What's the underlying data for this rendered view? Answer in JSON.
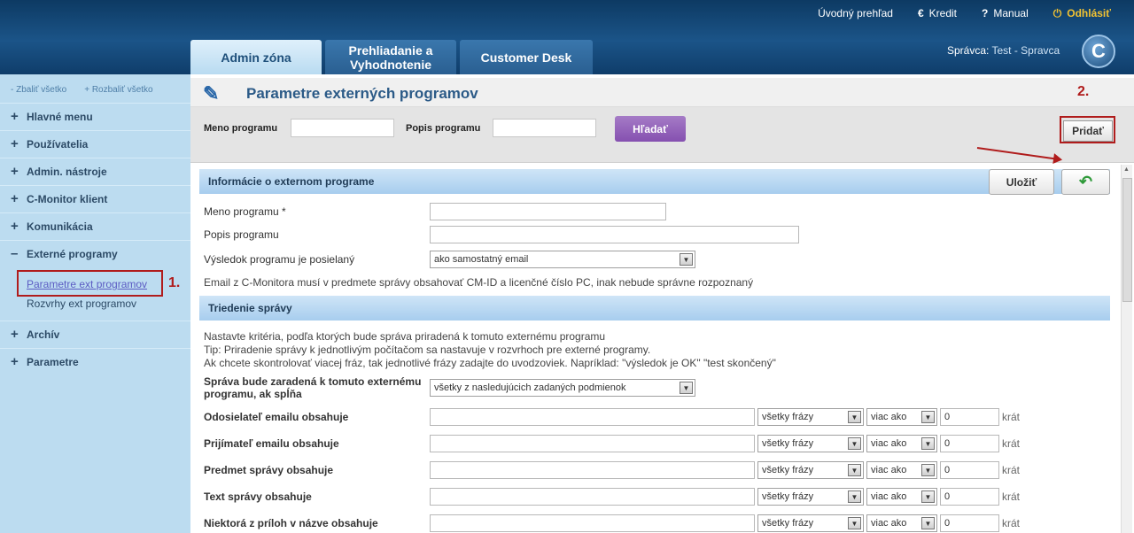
{
  "top_links": {
    "home": "Úvodný prehľad",
    "credit": "Kredit",
    "manual": "Manual",
    "logout": "Odhlásiť"
  },
  "tabs": [
    {
      "label": "Admin zóna"
    },
    {
      "label": "Prehliadanie a Vyhodnotenie"
    },
    {
      "label": "Customer Desk"
    }
  ],
  "user": {
    "prefix": "Správca:",
    "name": "Test - Spravca"
  },
  "logo": "C",
  "sidebar": {
    "collapse_all": "- Zbaliť všetko",
    "expand_all": "+ Rozbaliť všetko",
    "items": [
      {
        "label": "Hlavné menu",
        "sign": "+"
      },
      {
        "label": "Používatelia",
        "sign": "+"
      },
      {
        "label": "Admin. nástroje",
        "sign": "+"
      },
      {
        "label": "C-Monitor klient",
        "sign": "+"
      },
      {
        "label": "Komunikácia",
        "sign": "+"
      },
      {
        "label": "Externé programy",
        "sign": "–"
      },
      {
        "label": "Archív",
        "sign": "+"
      },
      {
        "label": "Parametre",
        "sign": "+"
      }
    ],
    "subitems": [
      {
        "label": "Parametre ext programov"
      },
      {
        "label": "Rozvrhy ext programov"
      }
    ]
  },
  "annotations": {
    "one": "1.",
    "two": "2."
  },
  "page": {
    "title": "Parametre externých programov"
  },
  "search": {
    "name_label": "Meno programu",
    "desc_label": "Popis programu",
    "search_button": "Hľadať",
    "add_button": "Pridať"
  },
  "form": {
    "save_button": "Uložiť",
    "section_info": "Informácie o externom programe",
    "name_label": "Meno programu *",
    "desc_label": "Popis programu",
    "result_label": "Výsledok programu je posielaný",
    "result_value": "ako samostatný email",
    "email_note": "Email z C-Monitora musí v predmete správy obsahovať CM-ID a licenčné číslo PC, inak nebude správne rozpoznaný",
    "section_sort": "Triedenie správy",
    "sort_note_1": "Nastavte kritéria, podľa ktorých bude správa priradená k tomuto externému programu",
    "sort_note_2": "Tip: Priradenie správy k jednotlivým počítačom sa nastavuje v rozvrhoch pre externé programy.",
    "sort_note_3": "Ak chcete skontrolovať viacej fráz, tak jednotlivé frázy zadajte do uvodzoviek. Napríklad: \"výsledok je OK\" \"test skončený\"",
    "match_label": "Správa bude zaradená k tomuto externému programu, ak spĺňa",
    "match_value": "všetky z nasledujúcich zadaných podmienok",
    "krat": "krát",
    "rows": [
      {
        "label": "Odosielateľ emailu obsahuje",
        "phrase": "všetky frázy",
        "cmp": "viac ako",
        "count": "0"
      },
      {
        "label": "Prijímateľ emailu obsahuje",
        "phrase": "všetky frázy",
        "cmp": "viac ako",
        "count": "0"
      },
      {
        "label": "Predmet správy obsahuje",
        "phrase": "všetky frázy",
        "cmp": "viac ako",
        "count": "0"
      },
      {
        "label": "Text správy obsahuje",
        "phrase": "všetky frázy",
        "cmp": "viac ako",
        "count": "0"
      },
      {
        "label": "Niektorá z príloh v názve obsahuje",
        "phrase": "všetky frázy",
        "cmp": "viac ako",
        "count": "0"
      }
    ]
  }
}
